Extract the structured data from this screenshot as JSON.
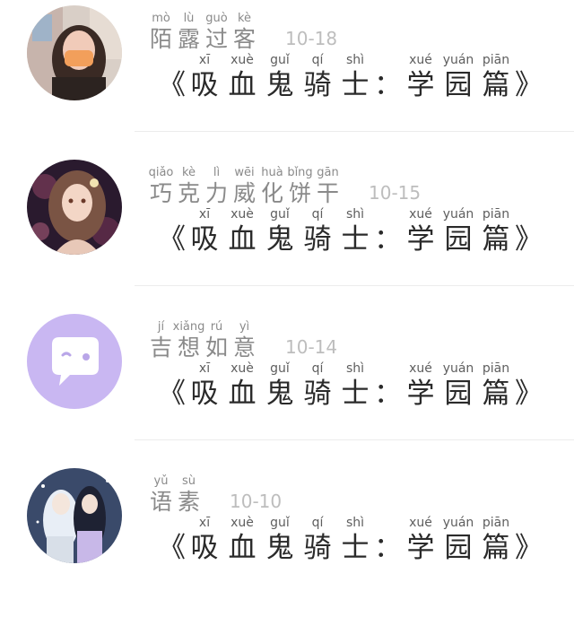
{
  "items": [
    {
      "name_chars": [
        "陌",
        "露",
        "过",
        "客"
      ],
      "name_pinyin": [
        "mò",
        "lù",
        "guò",
        "kè"
      ],
      "date": "10-18",
      "title_open": "《",
      "title_chars": [
        "吸",
        "血",
        "鬼",
        "骑",
        "士"
      ],
      "title_pinyin": [
        "xī",
        "xuè",
        "guǐ",
        "qí",
        "shì"
      ],
      "title_colon": "：",
      "title_chars2": [
        "学",
        "园",
        "篇"
      ],
      "title_pinyin2": [
        "xué",
        "yuán",
        "piān"
      ],
      "title_close": "》"
    },
    {
      "name_chars": [
        "巧",
        "克",
        "力",
        "威",
        "化",
        "饼",
        "干"
      ],
      "name_pinyin": [
        "qiǎo",
        "kè",
        "lì",
        "wēi",
        "huà",
        "bǐng",
        "gān"
      ],
      "date": "10-15",
      "title_open": "《",
      "title_chars": [
        "吸",
        "血",
        "鬼",
        "骑",
        "士"
      ],
      "title_pinyin": [
        "xī",
        "xuè",
        "guǐ",
        "qí",
        "shì"
      ],
      "title_colon": "：",
      "title_chars2": [
        "学",
        "园",
        "篇"
      ],
      "title_pinyin2": [
        "xué",
        "yuán",
        "piān"
      ],
      "title_close": "》"
    },
    {
      "name_chars": [
        "吉",
        "想",
        "如",
        "意"
      ],
      "name_pinyin": [
        "jí",
        "xiǎng",
        "rú",
        "yì"
      ],
      "date": "10-14",
      "title_open": "《",
      "title_chars": [
        "吸",
        "血",
        "鬼",
        "骑",
        "士"
      ],
      "title_pinyin": [
        "xī",
        "xuè",
        "guǐ",
        "qí",
        "shì"
      ],
      "title_colon": "：",
      "title_chars2": [
        "学",
        "园",
        "篇"
      ],
      "title_pinyin2": [
        "xué",
        "yuán",
        "piān"
      ],
      "title_close": "》"
    },
    {
      "name_chars": [
        "语",
        "素"
      ],
      "name_pinyin": [
        "yǔ",
        "sù"
      ],
      "date": "10-10",
      "title_open": "《",
      "title_chars": [
        "吸",
        "血",
        "鬼",
        "骑",
        "士"
      ],
      "title_pinyin": [
        "xī",
        "xuè",
        "guǐ",
        "qí",
        "shì"
      ],
      "title_colon": "：",
      "title_chars2": [
        "学",
        "园",
        "篇"
      ],
      "title_pinyin2": [
        "xué",
        "yuán",
        "piān"
      ],
      "title_close": "》"
    }
  ],
  "avatar_icons": [
    "photo-avatar-icon",
    "anime-girl-avatar-icon",
    "chat-bubble-avatar-icon",
    "anime-couple-avatar-icon"
  ],
  "colors": {
    "name_text": "#8a8a8a",
    "date_text": "#bdbdbd",
    "title_text": "#2a2a2a",
    "purple_avatar": "#c9b7f2"
  }
}
